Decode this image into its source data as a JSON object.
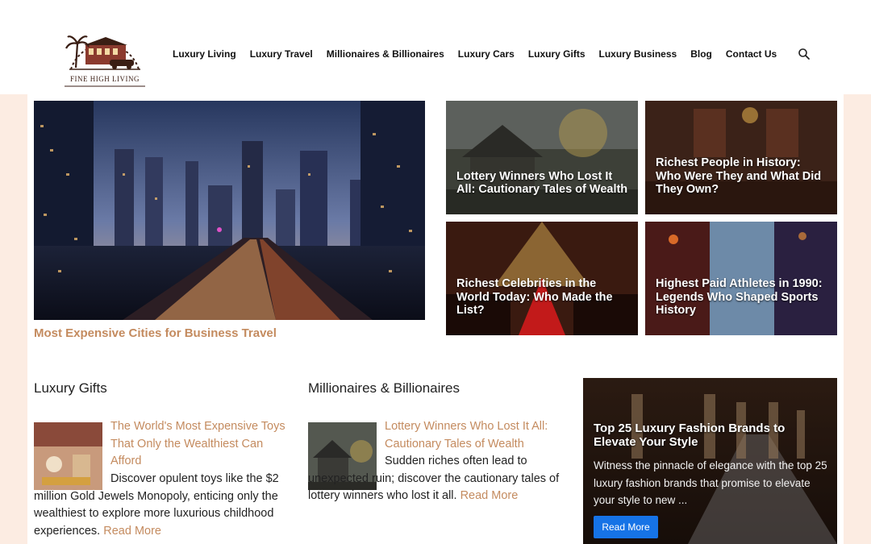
{
  "site": {
    "logo_text": "FINE HIGH LIVING"
  },
  "nav": {
    "items": [
      "Luxury Living",
      "Luxury Travel",
      "Millionaires & Billionaires",
      "Luxury Cars",
      "Luxury Gifts",
      "Luxury Business",
      "Blog",
      "Contact Us"
    ],
    "search_icon": "search-icon"
  },
  "hero": {
    "title": "Most Expensive Cities for Business Travel"
  },
  "cards": [
    {
      "title": "Lottery Winners Who Lost It All: Cautionary Tales of Wealth"
    },
    {
      "title": "Richest People in History: Who Were They and What Did They Own?"
    },
    {
      "title": "Richest Celebrities in the World Today: Who Made the List?"
    },
    {
      "title": "Highest Paid Athletes in 1990: Legends Who Shaped Sports History"
    }
  ],
  "sections": [
    {
      "heading": "Luxury Gifts",
      "post_title": "The World's Most Expensive Toys That Only the Wealthiest Can Afford",
      "excerpt": "Discover opulent toys like the $2 million Gold Jewels Monopoly, enticing only the wealthiest to explore more luxurious childhood experiences.",
      "read_more": "Read More"
    },
    {
      "heading": "Millionaires & Billionaires",
      "post_title": "Lottery Winners Who Lost It All: Cautionary Tales of Wealth",
      "excerpt": "Sudden riches often lead to unexpected ruin; discover the cautionary tales of lottery winners who lost it all.",
      "read_more": "Read More"
    }
  ],
  "feature": {
    "title": "Top 25 Luxury Fashion Brands to Elevate Your Style",
    "excerpt": "Witness the pinnacle of elegance with the top 25 luxury fashion brands that promise to elevate your style to new ...",
    "button": "Read More"
  },
  "colors": {
    "accent": "#c48b5f",
    "button": "#1673e6",
    "page_bg": "#fcece2"
  }
}
